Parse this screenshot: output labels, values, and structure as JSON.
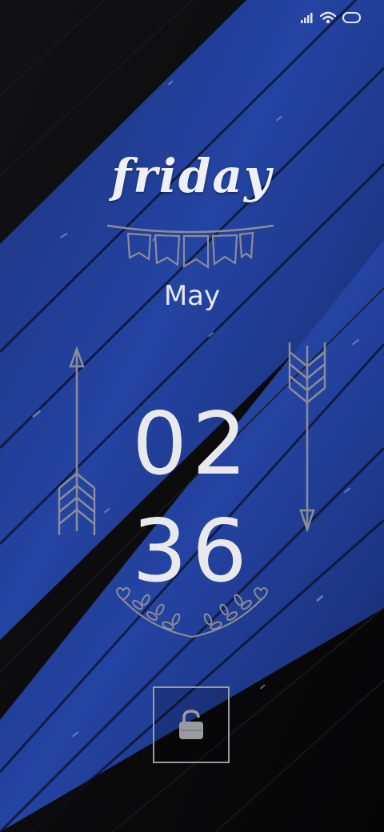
{
  "lockscreen": {
    "day": "friday",
    "month": "May",
    "time": {
      "hours": "02",
      "minutes": "36"
    }
  },
  "status_bar": {
    "icons": [
      "signal-bars-icon",
      "wifi-icon",
      "battery-icon"
    ]
  },
  "colors": {
    "background": "#0b0b0d",
    "wood_blue": "#1f3a8f",
    "text": "#eceef4",
    "ornament_gray": "#8c8c95"
  },
  "unlock": {
    "icon": "padlock-open-icon"
  }
}
